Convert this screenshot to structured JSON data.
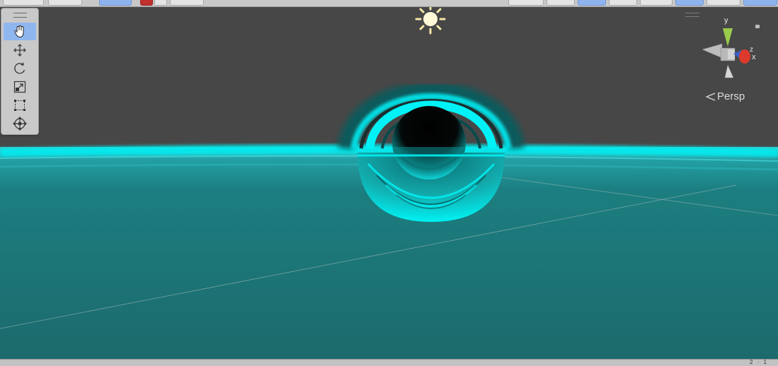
{
  "toolbar": {
    "tools": [
      {
        "id": "hand",
        "icon": "hand-icon",
        "active": true
      },
      {
        "id": "move",
        "icon": "move-icon",
        "active": false
      },
      {
        "id": "rotate",
        "icon": "rotate-icon",
        "active": false
      },
      {
        "id": "scale",
        "icon": "scale-icon",
        "active": false
      },
      {
        "id": "rect",
        "icon": "rect-transform-icon",
        "active": false
      },
      {
        "id": "transform",
        "icon": "transform-icon",
        "active": false
      }
    ]
  },
  "gizmo": {
    "y_label": "y",
    "z_label": "z",
    "x_label": "x",
    "projection_label": "Persp"
  },
  "status": {
    "right_text": "2 · 1"
  },
  "colors": {
    "active_tool": "#8fb6ef",
    "water": "#1f6f72",
    "glow": "#00f0f4",
    "y_axis": "#a4d35a",
    "x_axis": "#e23a2c"
  }
}
